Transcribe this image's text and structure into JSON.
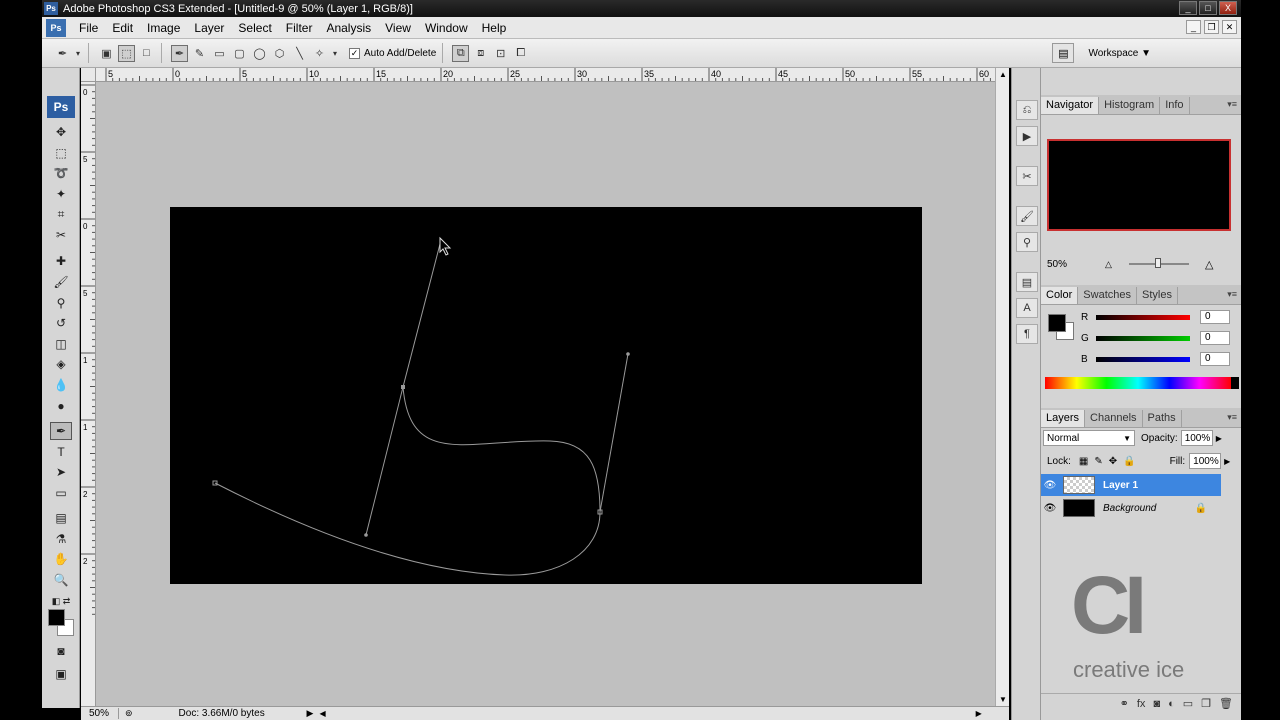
{
  "window": {
    "title": "Adobe Photoshop CS3 Extended - [Untitled-9 @ 50% (Layer 1, RGB/8)]",
    "minimize": "_",
    "maximize": "□",
    "close": "X"
  },
  "menu": {
    "ps_logo": "Ps",
    "items": [
      "File",
      "Edit",
      "Image",
      "Layer",
      "Select",
      "Filter",
      "Analysis",
      "View",
      "Window",
      "Help"
    ]
  },
  "options": {
    "auto_add_delete": "Auto Add/Delete",
    "auto_add_delete_checked": true,
    "workspace": "Workspace ▼"
  },
  "ruler": {
    "top_labels": [
      "5",
      "0",
      "5",
      "10",
      "15",
      "20",
      "25",
      "30",
      "35",
      "40",
      "45",
      "50",
      "55",
      "60"
    ],
    "left_labels": [
      "0",
      "5",
      "0",
      "5",
      "1",
      "1",
      "2",
      "2"
    ]
  },
  "toolbox": {
    "ps_label": "Ps"
  },
  "status": {
    "zoom": "50%",
    "doc": "Doc: 3.66M/0 bytes"
  },
  "navigator": {
    "tabs": [
      "Navigator",
      "Histogram",
      "Info"
    ],
    "zoom": "50%"
  },
  "color": {
    "tabs": [
      "Color",
      "Swatches",
      "Styles"
    ],
    "channels": [
      {
        "label": "R",
        "value": "0",
        "color": "#ff0000"
      },
      {
        "label": "G",
        "value": "0",
        "color": "#00cc00"
      },
      {
        "label": "B",
        "value": "0",
        "color": "#0000ff"
      }
    ]
  },
  "layers": {
    "tabs": [
      "Layers",
      "Channels",
      "Paths"
    ],
    "blend_mode": "Normal",
    "opacity_label": "Opacity:",
    "opacity": "100%",
    "lock_label": "Lock:",
    "fill_label": "Fill:",
    "fill": "100%",
    "items": [
      {
        "name": "Layer 1",
        "selected": true
      },
      {
        "name": "Background",
        "selected": false
      }
    ]
  },
  "watermark": {
    "big": "CI",
    "small": "creative ice"
  },
  "colors": {
    "canvas": "#000000",
    "pasteboard": "#c0c0c0",
    "path_stroke": "#9a9a9a",
    "selected_layer": "#3d86e0",
    "nav_frame": "#c83030"
  }
}
